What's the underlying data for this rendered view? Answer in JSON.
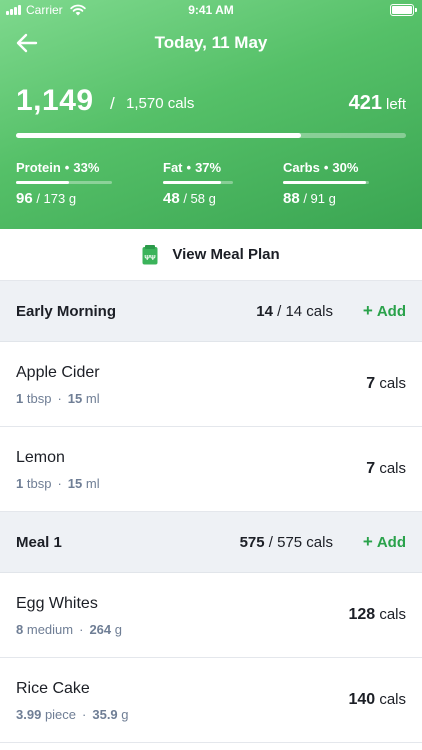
{
  "status_bar": {
    "carrier": "Carrier",
    "time": "9:41 AM"
  },
  "header": {
    "title": "Today, 11 May",
    "calories_eaten": "1,149",
    "calories_separator": "/",
    "calories_target": "1,570 cals",
    "calories_left_value": "421",
    "calories_left_label": "left",
    "calories_progress": 0.73
  },
  "macros": [
    {
      "name": "Protein",
      "percent": "33%",
      "eaten": "96",
      "target": "/ 173 g",
      "progress": 0.55
    },
    {
      "name": "Fat",
      "percent": "37%",
      "eaten": "48",
      "target": "/ 58 g",
      "progress": 0.83
    },
    {
      "name": "Carbs",
      "percent": "30%",
      "eaten": "88",
      "target": "/ 91 g",
      "progress": 0.97
    }
  ],
  "meal_plan": {
    "label": "View Meal Plan",
    "icon": "meal-plan-icon"
  },
  "sections": [
    {
      "title": "Early Morning",
      "cals_eaten": "14",
      "cals_target": "/ 14 cals",
      "add_label": "Add",
      "foods": [
        {
          "name": "Apple Cider",
          "qty": "1",
          "unit": "tbsp",
          "measure_value": "15",
          "measure_unit": "ml",
          "cals": "7",
          "cals_unit": "cals"
        },
        {
          "name": "Lemon",
          "qty": "1",
          "unit": "tbsp",
          "measure_value": "15",
          "measure_unit": "ml",
          "cals": "7",
          "cals_unit": "cals"
        }
      ]
    },
    {
      "title": "Meal 1",
      "cals_eaten": "575",
      "cals_target": "/ 575 cals",
      "add_label": "Add",
      "foods": [
        {
          "name": "Egg Whites",
          "qty": "8",
          "unit": "medium",
          "measure_value": "264",
          "measure_unit": "g",
          "cals": "128",
          "cals_unit": "cals"
        },
        {
          "name": "Rice Cake",
          "qty": "3.99",
          "unit": "piece",
          "measure_value": "35.9",
          "measure_unit": "g",
          "cals": "140",
          "cals_unit": "cals"
        }
      ]
    }
  ],
  "colors": {
    "header_start": "#7fd98e",
    "header_end": "#3aa552",
    "accent": "#2aa24b",
    "section_bg": "#eef1f5",
    "muted_text": "#6f7e95"
  }
}
